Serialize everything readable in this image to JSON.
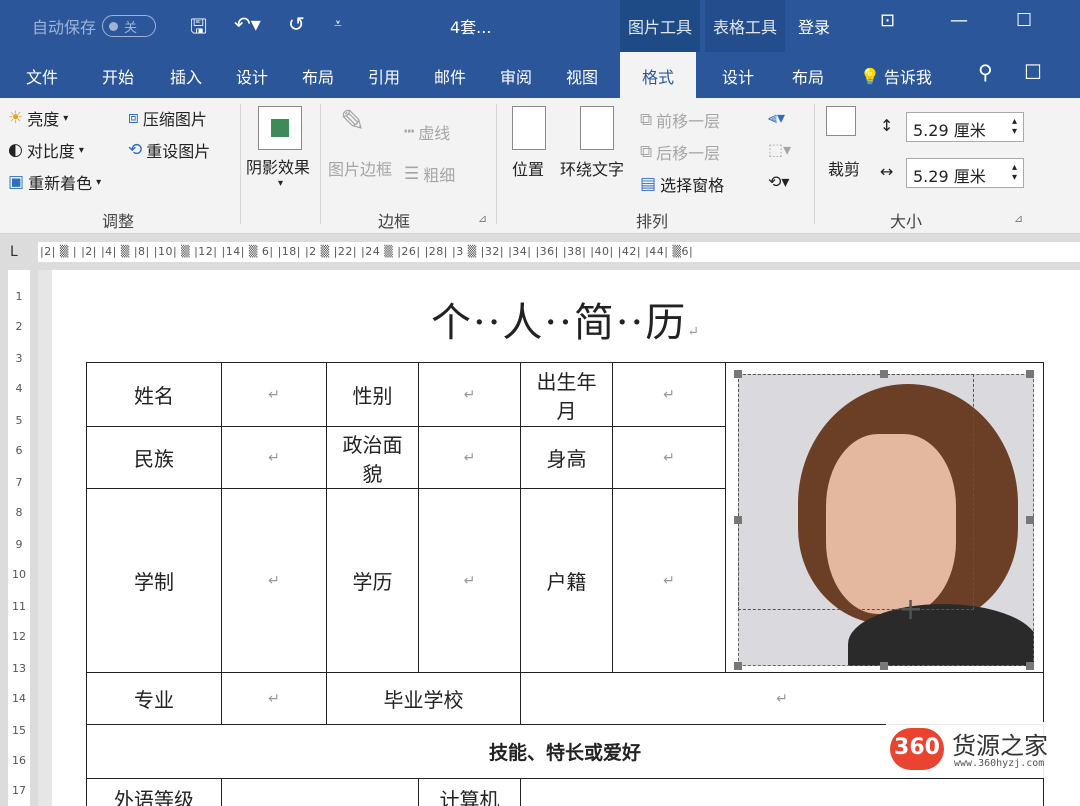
{
  "titlebar": {
    "autosave_label": "自动保存",
    "autosave_state": "关",
    "doc_title": "4套...",
    "context_tabs": [
      "图片工具",
      "表格工具"
    ],
    "login": "登录"
  },
  "tabs": [
    "文件",
    "开始",
    "插入",
    "设计",
    "布局",
    "引用",
    "邮件",
    "审阅",
    "视图",
    "格式",
    "设计",
    "布局"
  ],
  "active_tab": "格式",
  "tellme": "告诉我",
  "ribbon": {
    "adjust": {
      "label": "调整",
      "brightness": "亮度",
      "contrast": "对比度",
      "recolor": "重新着色",
      "compress": "压缩图片",
      "reset": "重设图片"
    },
    "shadow": {
      "label": "阴影效果"
    },
    "border": {
      "label": "边框",
      "picture_border": "图片边框",
      "dashes": "虚线",
      "weight": "粗细"
    },
    "arrange": {
      "label": "排列",
      "position": "位置",
      "wrap": "环绕文字",
      "bring_forward": "前移一层",
      "send_backward": "后移一层",
      "selection_pane": "选择窗格"
    },
    "size": {
      "label": "大小",
      "crop": "裁剪",
      "height": "5.29 厘米",
      "width": "5.29 厘米"
    }
  },
  "ruler": {
    "horizontal": "|2|  ▒  |  |2|  |4|      ▒     |8|  |10|  ▒ |12|  |14|  ▒ 6|  |18|  |2 ▒  |22|  |24 ▒ |26|  |28|  |3 ▒ |32|  |34|  |36|  |38|  |40|  |42|  |44|  ▒6|",
    "vertical": [
      "1",
      "2",
      "3",
      "4",
      "5",
      "6",
      "7",
      "8",
      "9",
      "10",
      "11",
      "12",
      "13",
      "14",
      "15",
      "16",
      "17"
    ]
  },
  "document": {
    "title": "个··人··简··历",
    "para_mark": "↵",
    "rows": {
      "name": "姓名",
      "gender": "性别",
      "birth": "出生年月",
      "ethnicity": "民族",
      "political": "政治面貌",
      "height": "身高",
      "schooling": "学制",
      "education": "学历",
      "hukou": "户籍",
      "major": "专业",
      "school": "毕业学校",
      "skills": "技能、特长或爱好",
      "partial_left": "外语等级",
      "partial_mid": "计算机"
    }
  },
  "watermark": {
    "badge": "360",
    "name": "货源之家",
    "url": "www.360hyzj.com"
  },
  "colors": {
    "title_bar": "#2b579a",
    "ribbon": "#f3f3f3",
    "accent": "#2b579a",
    "watermark_red": "#e8442f"
  }
}
